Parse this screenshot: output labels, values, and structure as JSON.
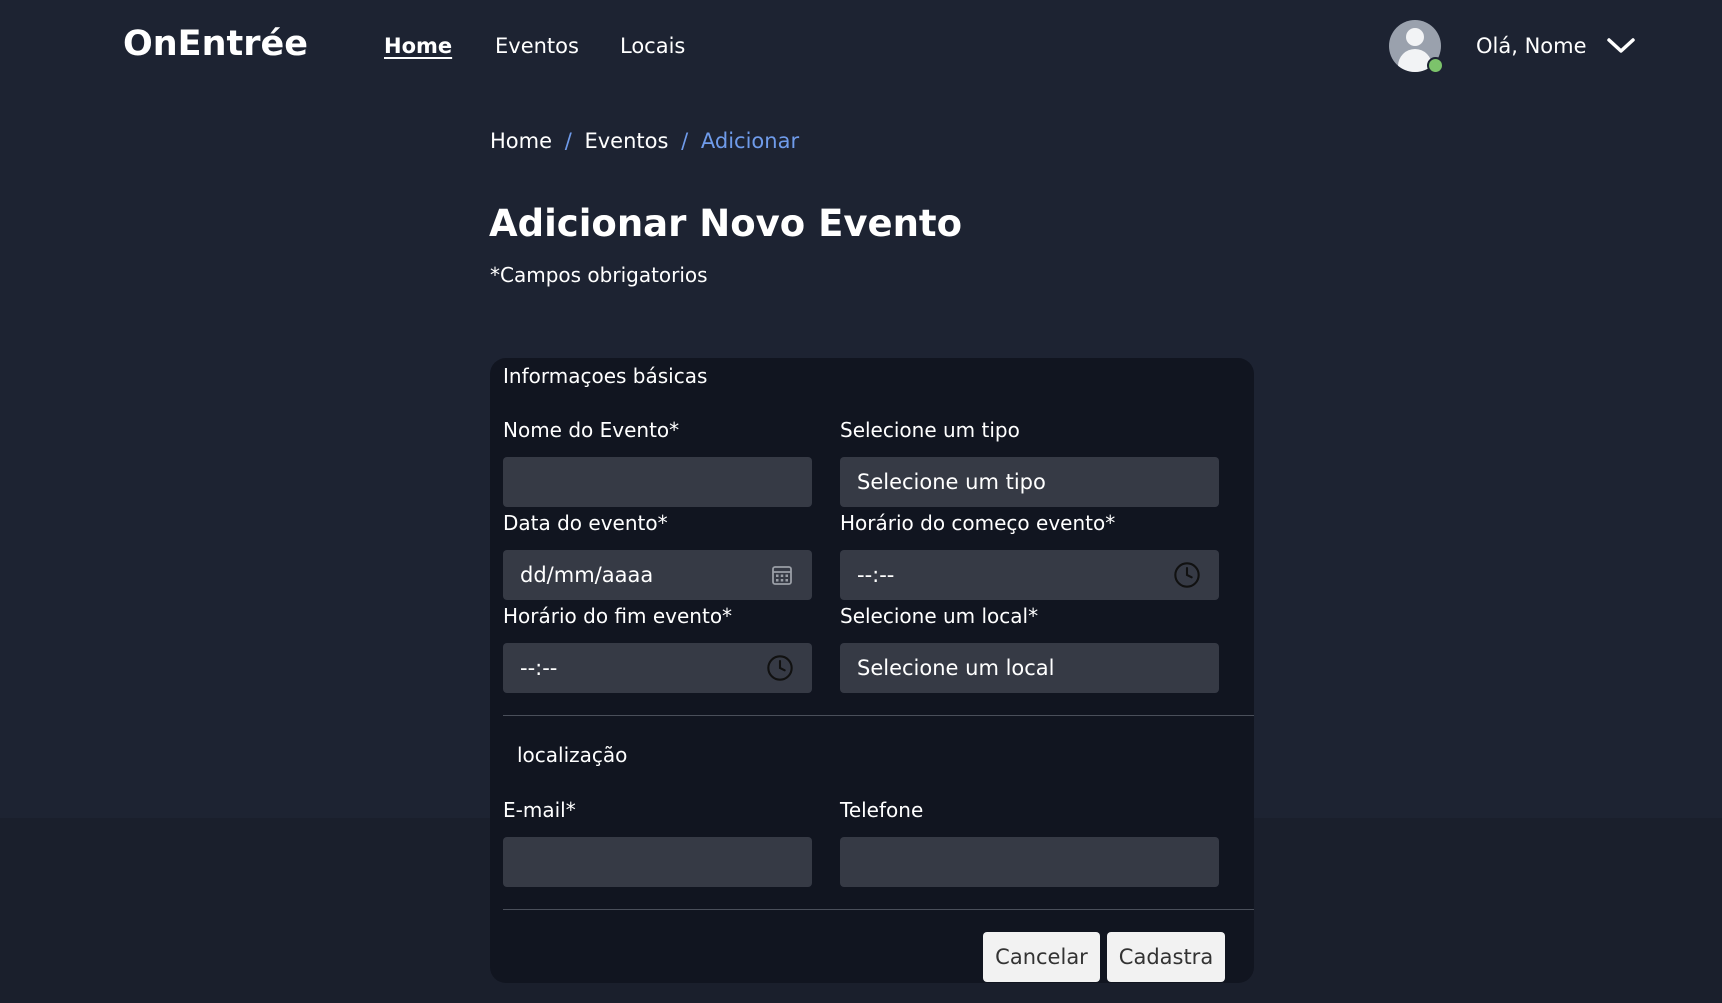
{
  "navbar": {
    "logo": "OnEntrée",
    "links": [
      "Home",
      "Eventos",
      "Locais"
    ],
    "greeting": "Olá, Nome"
  },
  "breadcrumb": {
    "items": [
      "Home",
      "Eventos"
    ],
    "separator": "/",
    "active": "Adicionar"
  },
  "page": {
    "title": "Adicionar Novo Evento",
    "required_note": "*Campos obrigatorios"
  },
  "form": {
    "section_basic": "Informaçoes básicas",
    "event_name": {
      "label": "Nome do Evento*",
      "value": ""
    },
    "type": {
      "label": "Selecione um tipo",
      "value": "Selecione um tipo"
    },
    "date": {
      "label": "Data do evento*",
      "placeholder": "dd/mm/aaaa"
    },
    "start_time": {
      "label": "Horário do começo evento*",
      "placeholder": "--:--"
    },
    "end_time": {
      "label": "Horário do fim evento*",
      "placeholder": "--:--"
    },
    "location": {
      "label": "Selecione um local*",
      "value": "Selecione um local"
    },
    "section_location": "localização",
    "email": {
      "label": "E-mail*",
      "value": ""
    },
    "phone": {
      "label": "Telefone",
      "value": ""
    },
    "cancel_label": "Cancelar",
    "submit_label": "Cadastra"
  },
  "icons": {
    "avatar": "user-avatar-icon",
    "status": "online-status-icon",
    "dropdown": "chevron-down-icon",
    "date": "calendar-icon",
    "time": "clock-icon"
  },
  "colors": {
    "background": "#1d2332",
    "card": "#111520",
    "input": "#363a45",
    "accent": "#6f9bea",
    "online": "#7cc36b"
  }
}
